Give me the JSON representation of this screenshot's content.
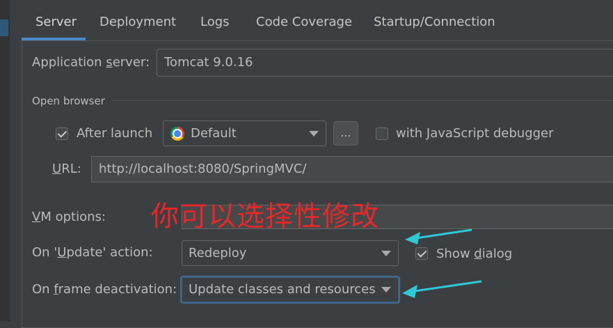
{
  "tabs": [
    {
      "label": "Server"
    },
    {
      "label": "Deployment"
    },
    {
      "label": "Logs"
    },
    {
      "label": "Code Coverage"
    },
    {
      "label": "Startup/Connection"
    }
  ],
  "active_tab": "Server",
  "server": {
    "app_server_label_pre": "Application ",
    "app_server_label_u": "s",
    "app_server_label_post": "erver:",
    "app_server_value": "Tomcat 9.0.16"
  },
  "open_browser": {
    "section_label": "Open browser",
    "after_launch_label": "After launch",
    "after_launch_checked": true,
    "browser_value": "Default",
    "browse_button_label": "...",
    "js_debugger_label_pre": "with ",
    "js_debugger_label_u": "J",
    "js_debugger_label_post": "avaScript debugger",
    "js_debugger_checked": false,
    "url_label_u": "U",
    "url_label_post": "RL:",
    "url_value": "http://localhost:8080/SpringMVC/"
  },
  "vm": {
    "label_u": "V",
    "label_post": "M options:",
    "value": ""
  },
  "update": {
    "label_pre": "On '",
    "label_u": "U",
    "label_post": "pdate' action:",
    "value": "Redeploy",
    "show_dialog_pre": "Show ",
    "show_dialog_u": "d",
    "show_dialog_post": "ialog",
    "show_dialog_checked": true
  },
  "frame": {
    "label_pre": "On ",
    "label_u": "f",
    "label_post": "rame deactivation:",
    "value": "Update classes and resources"
  },
  "annotation": {
    "text": "你可以选择性修改",
    "color": "#e8262a",
    "arrow_color": "#2ec8d6"
  }
}
